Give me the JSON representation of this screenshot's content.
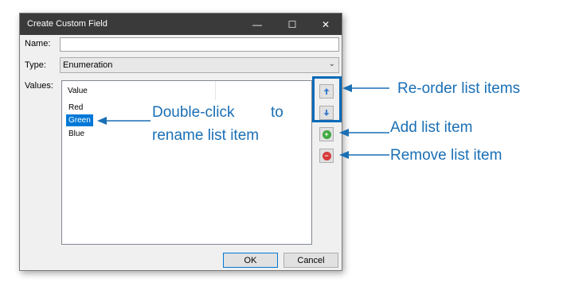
{
  "dialog": {
    "title": "Create Custom Field",
    "window_controls": {
      "minimize_glyph": "—",
      "maximize_glyph": "☐",
      "close_glyph": "✕"
    },
    "name_label": "Name:",
    "name_value": "",
    "type_label": "Type:",
    "type_value": "Enumeration",
    "values_label": "Values:",
    "list": {
      "column_header": "Value",
      "items": [
        "Red",
        "Green",
        "Blue"
      ],
      "selected_item": "Green"
    },
    "side_buttons": {
      "move_up_icon": "arrow-up-icon",
      "move_down_icon": "arrow-down-icon",
      "add_icon": "plus-icon",
      "remove_icon": "minus-icon",
      "add_glyph": "+",
      "remove_glyph": "−"
    },
    "ok_label": "OK",
    "cancel_label": "Cancel"
  },
  "annotations": {
    "reorder": "Re-order list items",
    "add": "Add list item",
    "remove": "Remove list item",
    "rename_line1_word1": "Double-click",
    "rename_line1_word2": "to",
    "rename_line2": "rename list item"
  },
  "colors": {
    "annotation_blue": "#1a6fb5",
    "selection_blue": "#0078d7",
    "add_green": "#3ea83e",
    "remove_red": "#d63b3b",
    "titlebar": "#3a3a3a"
  }
}
